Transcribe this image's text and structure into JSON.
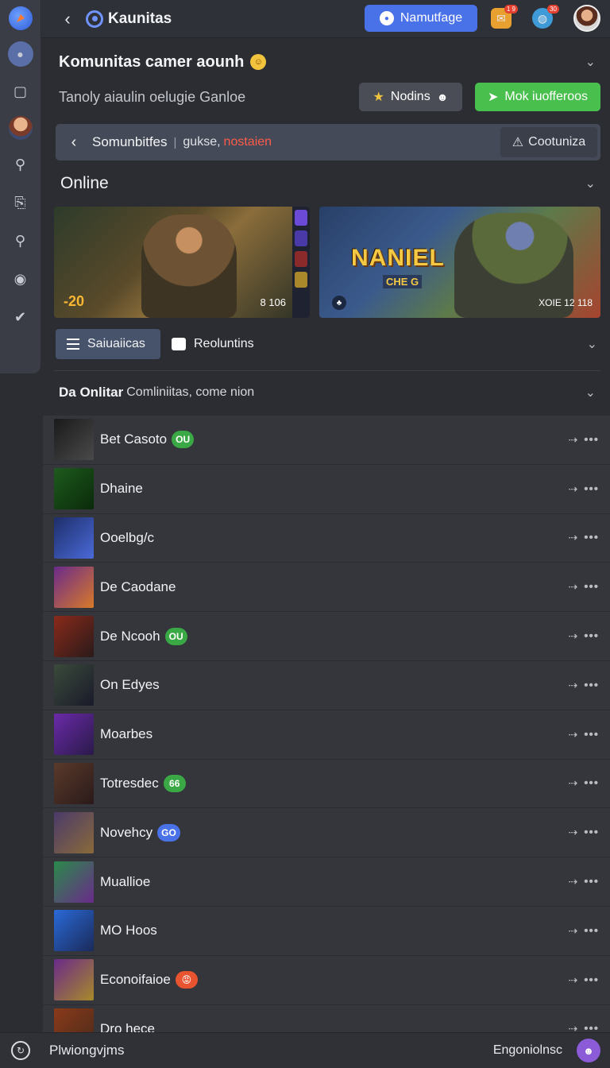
{
  "topbar": {
    "title": "Kaunitas",
    "primary_button": "Namutfage",
    "notif1_badge": "1 9",
    "notif2_badge": "30"
  },
  "header": {
    "title": "Komunitas camer aounh",
    "subtitle": "Tanoly aiaulin oelugie Ganloe",
    "secondary_button": "Nodins",
    "success_button": "Mok iuofferoos"
  },
  "breadcrumb": {
    "main": "Somunbitfes",
    "separator": "|",
    "sub": "gukse,",
    "highlight": "nostaien",
    "action": "Cootuniza"
  },
  "online": {
    "title": "Online",
    "card1": {
      "score": "-20",
      "count": "8 106"
    },
    "card2": {
      "logo": "NANIEL",
      "sub": "CHE G",
      "meta": "XOIE 12 118"
    }
  },
  "tabs": [
    {
      "label": "Saiuaiicas"
    },
    {
      "label": "Reoluntins"
    }
  ],
  "list_header": {
    "bold": "Da Onlitar",
    "rest": "Comliniitas, come nion"
  },
  "list": [
    {
      "name": "Bet Casoto",
      "badge": "OU",
      "badge_color": "#3aa845"
    },
    {
      "name": "Dhaine",
      "badge": "",
      "badge_color": ""
    },
    {
      "name": "Ooelbg/c",
      "badge": "",
      "badge_color": ""
    },
    {
      "name": "De Caodane",
      "badge": "",
      "badge_color": ""
    },
    {
      "name": "De Ncooh",
      "badge": "OU",
      "badge_color": "#3aa845"
    },
    {
      "name": "On Edyes",
      "badge": "",
      "badge_color": ""
    },
    {
      "name": "Moarbes",
      "badge": "",
      "badge_color": ""
    },
    {
      "name": "Totresdec",
      "badge": "66",
      "badge_color": "#3aa845"
    },
    {
      "name": "Novehcy",
      "badge": "GO",
      "badge_color": "#4a72e8"
    },
    {
      "name": "Muallioe",
      "badge": "",
      "badge_color": ""
    },
    {
      "name": "MO Hoos",
      "badge": "",
      "badge_color": ""
    },
    {
      "name": "Econoifaioe",
      "badge": "😡",
      "badge_color": "#e8542f"
    },
    {
      "name": "Dro hece",
      "badge": "",
      "badge_color": ""
    }
  ],
  "footer": {
    "left": "Plwiongvjms",
    "right": "Engoniolnsc"
  },
  "colors": {
    "accent": "#4a72e8",
    "success": "#49c04d",
    "highlight": "#ff5b4a"
  }
}
